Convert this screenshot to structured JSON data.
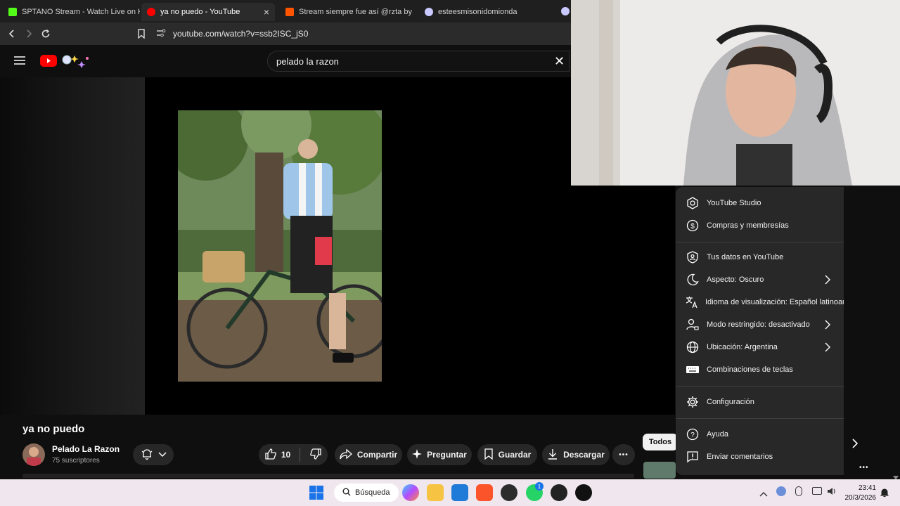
{
  "browser": {
    "tabs": [
      {
        "label": "SPTANO Stream - Watch Live on Kick",
        "favicon": "kick-icon",
        "color": "#53fc18"
      },
      {
        "label": "ya no puedo - YouTube",
        "favicon": "youtube-icon",
        "color": "#ff0000",
        "close": "×"
      },
      {
        "label": "Stream siempre fue así @rzta by pibe",
        "favicon": "soundcloud-icon",
        "color": "#ff5500"
      },
      {
        "label": "esteesmisonidomionda",
        "favicon": "generic-icon",
        "color": "#c9c9ff"
      }
    ],
    "url": "youtube.com/watch?v=ssb2ISC_jS0"
  },
  "youtube": {
    "search_value": "pelado la razon",
    "search_clear": "✕",
    "video_title": "ya no puedo",
    "channel_name": "Pelado La Razon",
    "subscribers": "75 suscriptores",
    "likes": "10",
    "actions": {
      "share": "Compartir",
      "ask": "Preguntar",
      "save": "Guardar",
      "download": "Descargar",
      "more": "•••"
    },
    "chip_all": "Todos"
  },
  "menu": {
    "items": [
      {
        "label": "YouTube Studio",
        "icon": "studio-icon"
      },
      {
        "label": "Compras y membresías",
        "icon": "dollar-icon"
      },
      {
        "label": "Tus datos en YouTube",
        "icon": "shield-person-icon"
      },
      {
        "label": "Aspecto: Oscuro",
        "icon": "moon-icon",
        "chevron": true
      },
      {
        "label": "Idioma de visualización: Español latinoamericano",
        "icon": "translate-icon"
      },
      {
        "label": "Modo restringido: desactivado",
        "icon": "person-lock-icon",
        "chevron": true
      },
      {
        "label": "Ubicación: Argentina",
        "icon": "globe-icon",
        "chevron": true
      },
      {
        "label": "Combinaciones de teclas",
        "icon": "keyboard-icon"
      },
      {
        "label": "Configuración",
        "icon": "gear-icon"
      },
      {
        "label": "Ayuda",
        "icon": "help-icon"
      },
      {
        "label": "Enviar comentarios",
        "icon": "feedback-icon"
      }
    ]
  },
  "taskbar": {
    "search_label": "Búsqueda",
    "time": "23:41",
    "date": "20/3/2026",
    "whatsapp_badge": "1"
  },
  "colors": {
    "accent": "#ff0000",
    "menu_bg": "#282828",
    "taskbar_bg": "#f0e7ee"
  }
}
